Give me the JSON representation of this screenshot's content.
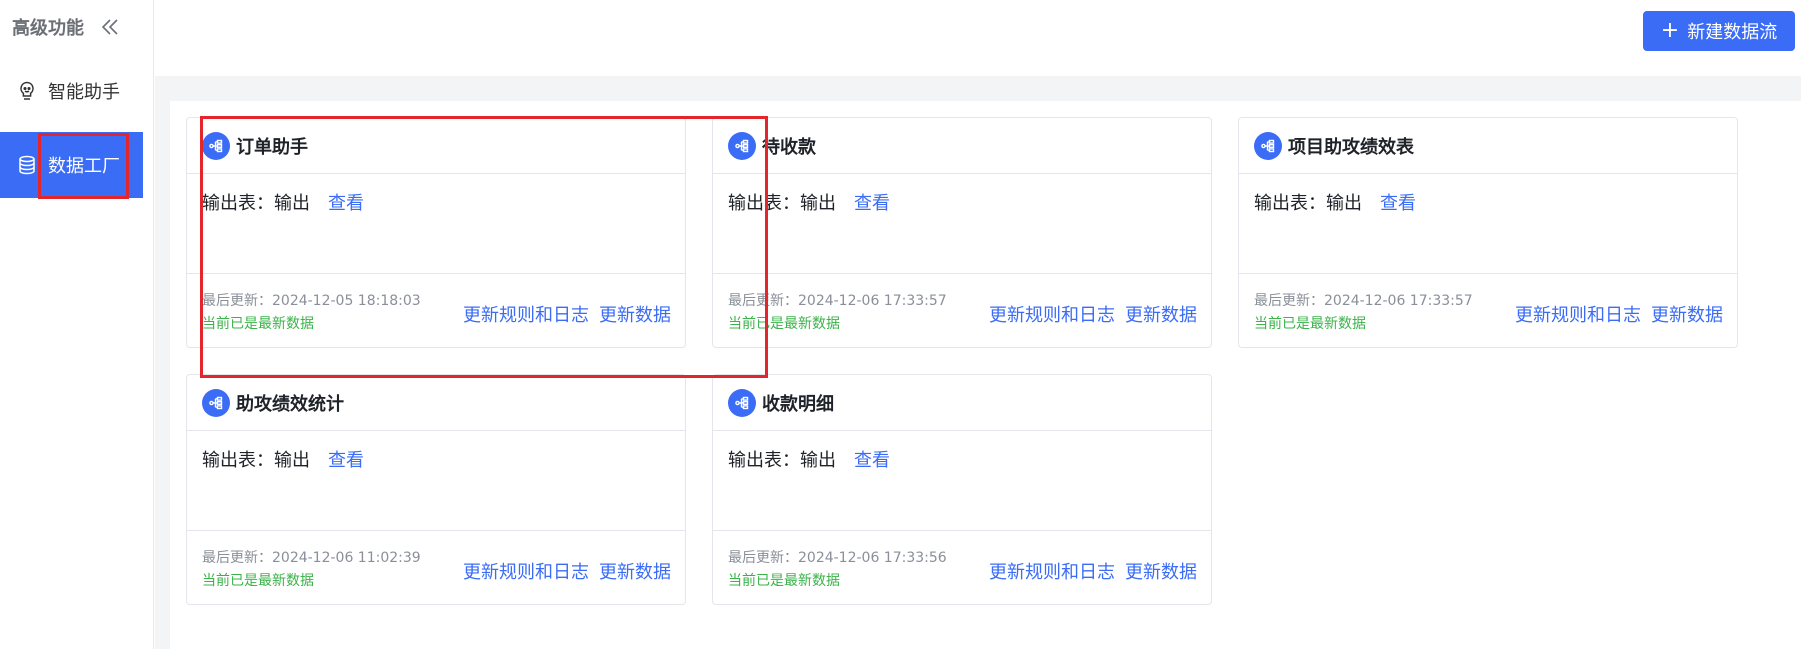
{
  "sidebar": {
    "title": "高级功能",
    "collapse_icon": "double-chevron-left-icon",
    "items": [
      {
        "label": "智能助手",
        "icon": "lightbulb-icon"
      },
      {
        "label": "数据工厂",
        "icon": "database-icon",
        "active": true
      }
    ]
  },
  "toolbar": {
    "new_button_label": "新建数据流",
    "new_button_icon": "plus-icon"
  },
  "colors": {
    "accent": "#3b6cf6",
    "success": "#3bb34a",
    "highlight": "#e3262b"
  },
  "cards": [
    {
      "title": "订单助手",
      "output_label": "输出表：输出",
      "view_label": "查看",
      "last_update": "最后更新：2024-12-05 18:18:03",
      "status": "当前已是最新数据",
      "rules_label": "更新规则和日志",
      "update_label": "更新数据"
    },
    {
      "title": "待收款",
      "output_label": "输出表：输出",
      "view_label": "查看",
      "last_update": "最后更新：2024-12-06 17:33:57",
      "status": "当前已是最新数据",
      "rules_label": "更新规则和日志",
      "update_label": "更新数据"
    },
    {
      "title": "项目助攻绩效表",
      "output_label": "输出表：输出",
      "view_label": "查看",
      "last_update": "最后更新：2024-12-06 17:33:57",
      "status": "当前已是最新数据",
      "rules_label": "更新规则和日志",
      "update_label": "更新数据"
    },
    {
      "title": "助攻绩效统计",
      "output_label": "输出表：输出",
      "view_label": "查看",
      "last_update": "最后更新：2024-12-06 11:02:39",
      "status": "当前已是最新数据",
      "rules_label": "更新规则和日志",
      "update_label": "更新数据"
    },
    {
      "title": "收款明细",
      "output_label": "输出表：输出",
      "view_label": "查看",
      "last_update": "最后更新：2024-12-06 17:33:56",
      "status": "当前已是最新数据",
      "rules_label": "更新规则和日志",
      "update_label": "更新数据"
    }
  ]
}
